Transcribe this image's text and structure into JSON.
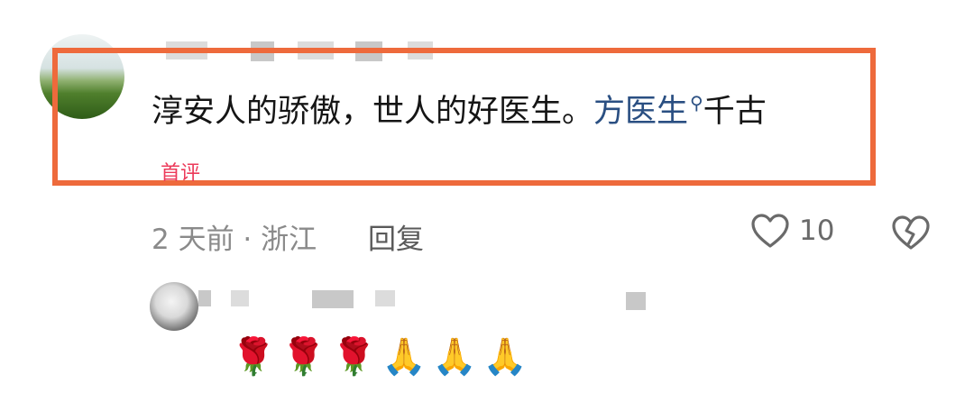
{
  "comment": {
    "text_main": "淳安人的骄傲，世人的好医生。",
    "mention": "方医生",
    "search_icon": "search-icon",
    "text_tail": "千古",
    "badge": "首评",
    "time_location": "2 天前 · 浙江",
    "reply_label": "回复",
    "like_count": "10",
    "like_icon": "heart-outline-icon",
    "dislike_icon": "broken-heart-icon"
  },
  "reply": {
    "text": "🌹🌹🌹🙏🙏🙏"
  },
  "colors": {
    "highlight_border": "#ee6a3c",
    "mention": "#2a4f82",
    "badge": "#ec3a5a"
  }
}
